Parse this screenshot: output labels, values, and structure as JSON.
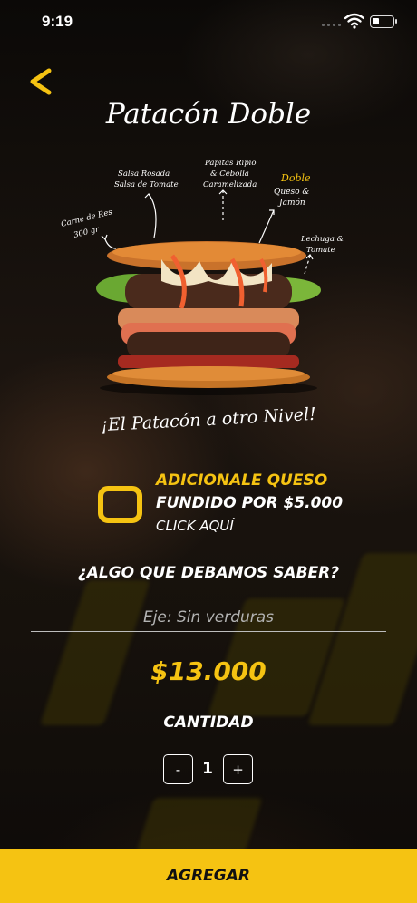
{
  "status_bar": {
    "time": "9:19",
    "icons": [
      "signal-icon",
      "wifi-icon",
      "battery-icon"
    ]
  },
  "header": {
    "back_icon": "chevron-left-icon",
    "title": "Patacón Doble"
  },
  "product_image": {
    "callouts": [
      "Carne de Res 300 gr",
      "Salsa Rosada Salsa de Tomate",
      "Papitas Ripio & Cebolla Caramelizada",
      "Doble Queso & Jamón",
      "Lechuga & Tomate"
    ],
    "tagline": "¡El Patacón a otro Nivel!"
  },
  "addon": {
    "line1": "ADICIONALE QUESO",
    "line2": "FUNDIDO POR $5.000",
    "line3": "CLICK AQUÍ"
  },
  "notes": {
    "question": "¿ALGO QUE DEBAMOS SABER?",
    "placeholder": "Eje: Sin verduras",
    "value": ""
  },
  "price": "$13.000",
  "quantity": {
    "label": "CANTIDAD",
    "minus_label": "-",
    "plus_label": "+",
    "value": "1"
  },
  "add_button": {
    "label": "AGREGAR"
  },
  "colors": {
    "accent": "#f5c312",
    "background": "#120d09",
    "text": "#ffffff"
  }
}
